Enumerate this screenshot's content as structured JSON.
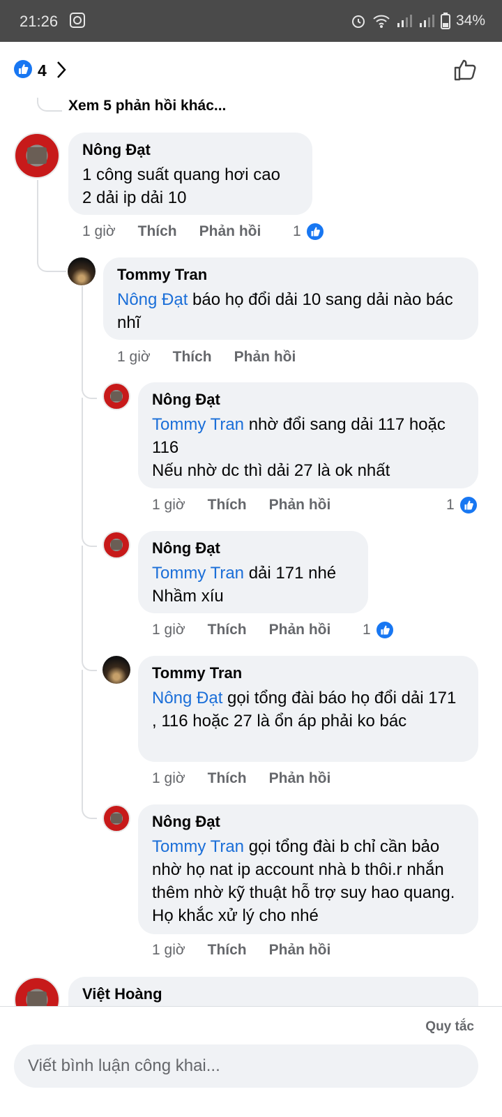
{
  "status_bar": {
    "time": "21:26",
    "battery": "34%"
  },
  "header": {
    "like_count": "4"
  },
  "thread": {
    "more_replies": "Xem 5 phản hồi khác..."
  },
  "comments": [
    {
      "author": "Nông Đạt",
      "mention": "",
      "text": "1 công suất quang hơi cao\n2 dải ip dải 10",
      "time": "1 giờ",
      "like": "Thích",
      "reply": "Phản hồi",
      "reactions": "1"
    },
    {
      "author": "Tommy Tran",
      "mention": "Nông Đạt",
      "text": " báo họ đổi dải 10 sang dải nào bác nhĩ",
      "time": "1 giờ",
      "like": "Thích",
      "reply": "Phản hồi",
      "reactions": ""
    },
    {
      "author": "Nông Đạt",
      "mention": "Tommy Tran",
      "text": " nhờ đổi sang dải 117 hoặc 116\nNếu nhờ dc thì dải 27 là ok nhất",
      "time": "1 giờ",
      "like": "Thích",
      "reply": "Phản hồi",
      "reactions": "1"
    },
    {
      "author": "Nông Đạt",
      "mention": "Tommy Tran",
      "text": " dải 171 nhé\nNhầm xíu",
      "time": "1 giờ",
      "like": "Thích",
      "reply": "Phản hồi",
      "reactions": "1"
    },
    {
      "author": "Tommy Tran",
      "mention": "Nông Đạt",
      "text": "  gọi tổng đài báo họ đổi dải 171 , 116 hoặc 27 là ổn áp phải ko bác",
      "time": "1 giờ",
      "like": "Thích",
      "reply": "Phản hồi",
      "reactions": ""
    },
    {
      "author": "Nông Đạt",
      "mention": "Tommy Tran",
      "text": " gọi tổng đài b chỉ cần bảo nhờ họ nat ip account nhà b thôi.r nhắn thêm nhờ kỹ thuật hỗ trợ suy hao quang. Họ khắc xử lý cho nhé",
      "time": "1 giờ",
      "like": "Thích",
      "reply": "Phản hồi",
      "reactions": ""
    },
    {
      "author": "Việt Hoàng"
    }
  ],
  "footer": {
    "rules": "Quy tắc",
    "placeholder": "Viết bình luận công khai..."
  },
  "colors": {
    "accent": "#1877f2",
    "mention": "#1a6ed8",
    "bubble": "#f0f2f5",
    "statusbar": "#4a4a4a"
  },
  "icons": [
    "messenger-icon",
    "alarm-icon",
    "wifi-icon",
    "signal-icon",
    "battery-icon",
    "like-icon",
    "chevron-right-icon",
    "thumbs-up-outline-icon"
  ]
}
